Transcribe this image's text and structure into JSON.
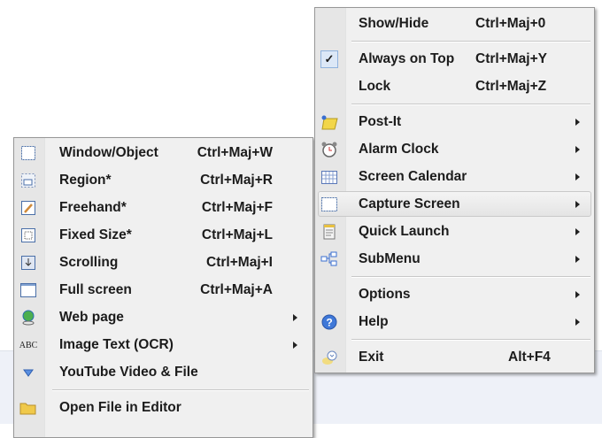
{
  "main_menu": {
    "items": [
      {
        "label": "Show/Hide",
        "shortcut": "Ctrl+Maj+0"
      },
      {
        "label": "Always on Top",
        "shortcut": "Ctrl+Maj+Y",
        "checked": true
      },
      {
        "label": "Lock",
        "shortcut": "Ctrl+Maj+Z"
      },
      {
        "label": "Post-It",
        "icon": "post-it-icon"
      },
      {
        "label": "Alarm Clock",
        "icon": "alarm-clock-icon"
      },
      {
        "label": "Screen Calendar",
        "icon": "calendar-icon"
      },
      {
        "label": "Capture Screen",
        "icon": "capture-icon",
        "highlighted": true
      },
      {
        "label": "Quick Launch",
        "icon": "quick-launch-icon"
      },
      {
        "label": "SubMenu",
        "icon": "submenu-icon"
      },
      {
        "label": "Options"
      },
      {
        "label": "Help",
        "icon": "help-icon"
      },
      {
        "label": "Exit",
        "shortcut": "Alt+F4",
        "icon": "exit-icon"
      }
    ],
    "check_glyph": "✓"
  },
  "capture_submenu": {
    "items": [
      {
        "label": "Window/Object",
        "shortcut": "Ctrl+Maj+W"
      },
      {
        "label": "Region*",
        "shortcut": "Ctrl+Maj+R"
      },
      {
        "label": "Freehand*",
        "shortcut": "Ctrl+Maj+F"
      },
      {
        "label": "Fixed Size*",
        "shortcut": "Ctrl+Maj+L"
      },
      {
        "label": "Scrolling",
        "shortcut": "Ctrl+Maj+I"
      },
      {
        "label": "Full screen",
        "shortcut": "Ctrl+Maj+A"
      },
      {
        "label": "Web page"
      },
      {
        "label": "Image Text (OCR)",
        "icon_text": "ABC"
      },
      {
        "label": "YouTube Video & File"
      },
      {
        "label": "Open File in Editor"
      }
    ]
  }
}
